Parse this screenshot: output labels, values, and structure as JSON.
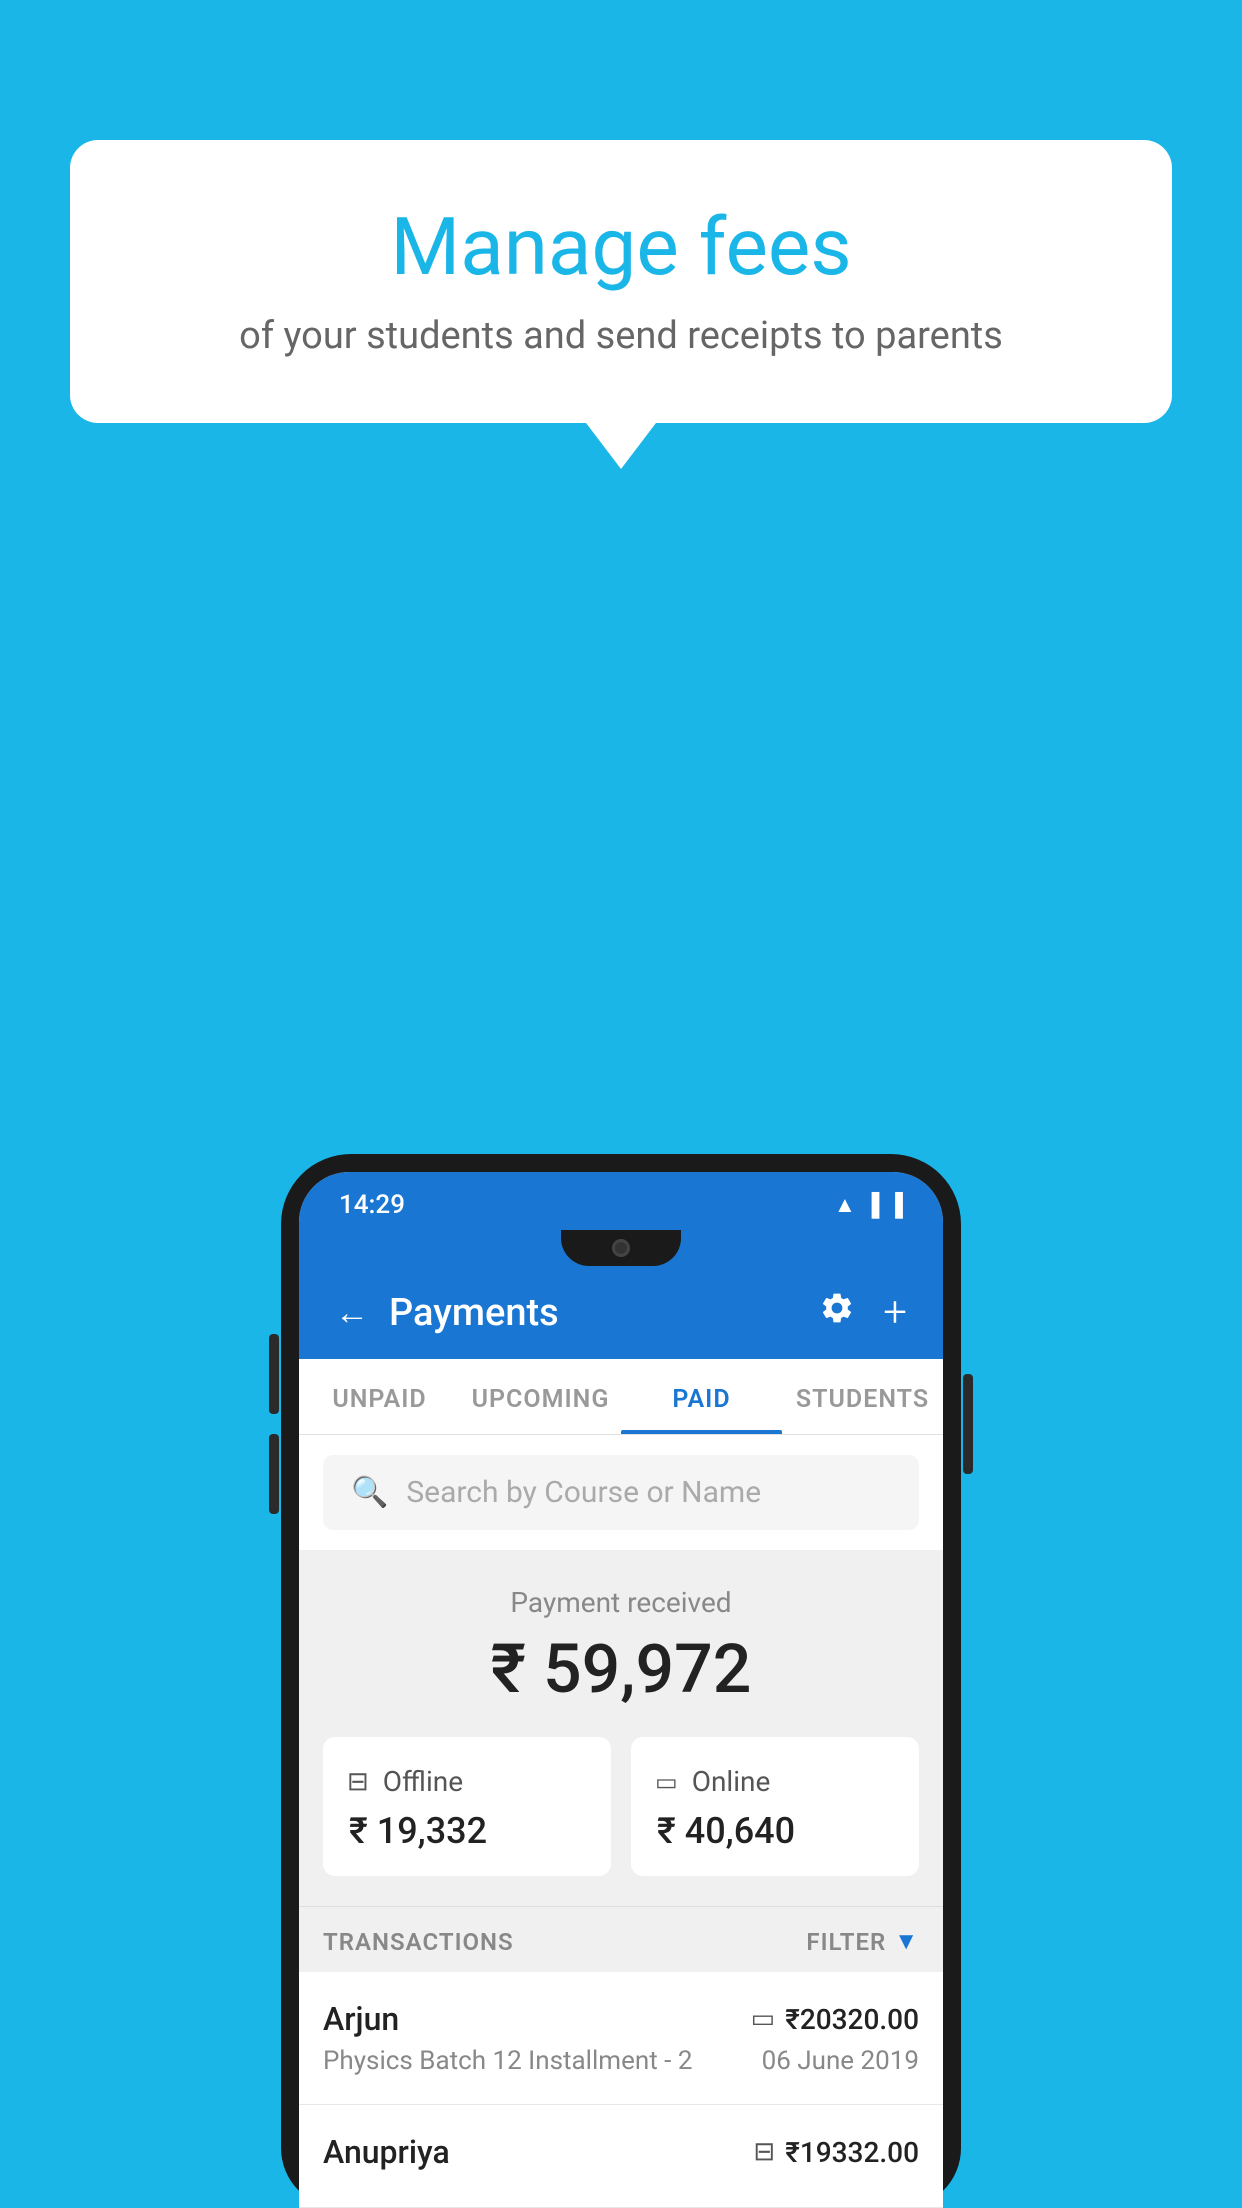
{
  "background_color": "#1ab6e8",
  "speech_bubble": {
    "title": "Manage fees",
    "subtitle": "of your students and send receipts to parents"
  },
  "status_bar": {
    "time": "14:29",
    "icons": [
      "wifi",
      "signal",
      "battery"
    ]
  },
  "app_bar": {
    "title": "Payments",
    "back_label": "←",
    "settings_label": "⚙",
    "add_label": "+"
  },
  "tabs": [
    {
      "label": "UNPAID",
      "active": false
    },
    {
      "label": "UPCOMING",
      "active": false
    },
    {
      "label": "PAID",
      "active": true
    },
    {
      "label": "STUDENTS",
      "active": false
    }
  ],
  "search": {
    "placeholder": "Search by Course or Name"
  },
  "payment_summary": {
    "received_label": "Payment received",
    "total_amount": "₹ 59,972",
    "offline": {
      "label": "Offline",
      "amount": "₹ 19,332"
    },
    "online": {
      "label": "Online",
      "amount": "₹ 40,640"
    }
  },
  "transactions": {
    "header_label": "TRANSACTIONS",
    "filter_label": "FILTER",
    "items": [
      {
        "name": "Arjun",
        "course": "Physics Batch 12 Installment - 2",
        "amount": "₹20320.00",
        "date": "06 June 2019",
        "payment_type": "card"
      },
      {
        "name": "Anupriya",
        "course": "",
        "amount": "₹19332.00",
        "date": "",
        "payment_type": "offline"
      }
    ]
  }
}
